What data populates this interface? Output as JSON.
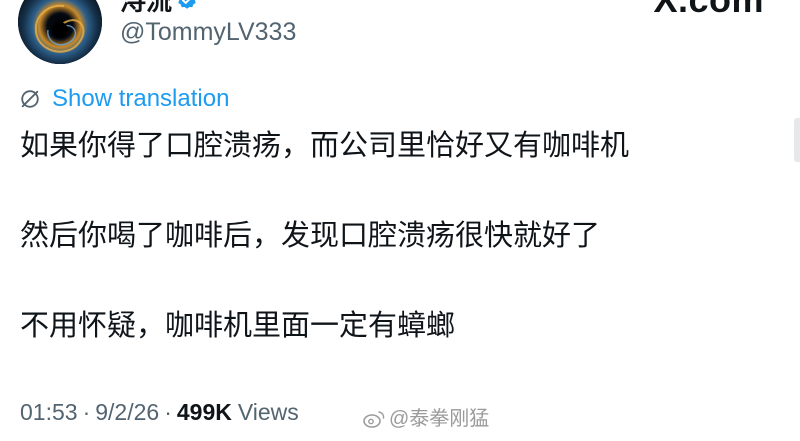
{
  "header": {
    "display_name": "浔流",
    "handle": "@TommyLV333",
    "brand": "X.com",
    "verified_icon": "verified-badge-icon"
  },
  "translation": {
    "label": "Show translation",
    "icon": "globe-slash-icon"
  },
  "tweet": {
    "lines": [
      "如果你得了口腔溃疡，而公司里恰好又有咖啡机",
      "然后你喝了咖啡后，发现口腔溃疡很快就好了",
      "不用怀疑，咖啡机里面一定有蟑螂"
    ]
  },
  "meta": {
    "time": "01:53",
    "separator": "·",
    "date": "9/2/26",
    "views_count": "499K",
    "views_label": "Views"
  },
  "watermark": {
    "text": "@泰拳刚猛",
    "icon": "weibo-icon"
  },
  "colors": {
    "link": "#1d9bf0",
    "secondary_text": "#536471",
    "primary_text": "#0f1419",
    "verified": "#1d9bf0"
  }
}
